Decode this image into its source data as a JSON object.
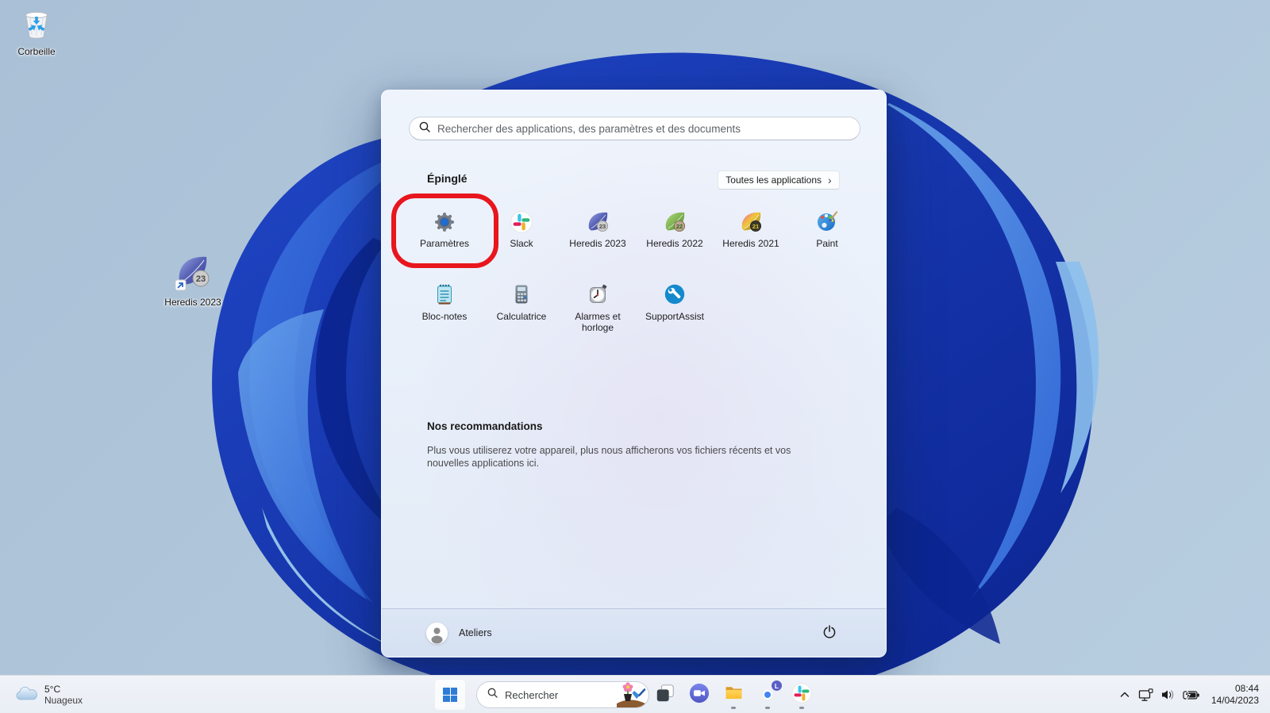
{
  "desktop": {
    "icons": [
      {
        "label": "Corbeille"
      },
      {
        "label": "Heredis 2023"
      }
    ]
  },
  "start_menu": {
    "search_placeholder": "Rechercher des applications, des paramètres et des documents",
    "pinned_header": "Épinglé",
    "all_apps_button": "Toutes les applications",
    "all_apps_chevron": "›",
    "pinned": [
      {
        "label": "Paramètres"
      },
      {
        "label": "Slack"
      },
      {
        "label": "Heredis 2023"
      },
      {
        "label": "Heredis 2022"
      },
      {
        "label": "Heredis 2021"
      },
      {
        "label": "Paint"
      },
      {
        "label": "Bloc-notes"
      },
      {
        "label": "Calculatrice"
      },
      {
        "label": "Alarmes et horloge"
      },
      {
        "label": "SupportAssist"
      }
    ],
    "recommended_header": "Nos recommandations",
    "recommended_empty_text": "Plus vous utiliserez votre appareil, plus nous afficherons vos fichiers récents et vos nouvelles applications ici.",
    "user_name": "Ateliers",
    "heredis_badges": {
      "b2023": "23",
      "b2022": "22",
      "b2021": "21"
    }
  },
  "taskbar": {
    "weather": {
      "temperature": "5°C",
      "condition": "Nuageux"
    },
    "search_label": "Rechercher",
    "clock": {
      "time": "08:44",
      "date": "14/04/2023"
    },
    "chrome_profile_badge": "L"
  },
  "colors": {
    "annotation_red": "#e8161d",
    "start_logo_blue": "#2f7cd8",
    "taskbar_bg": "#eef2f8",
    "bloom_dark_blue": "#0b2390",
    "bloom_mid_blue": "#2f6ad8"
  }
}
